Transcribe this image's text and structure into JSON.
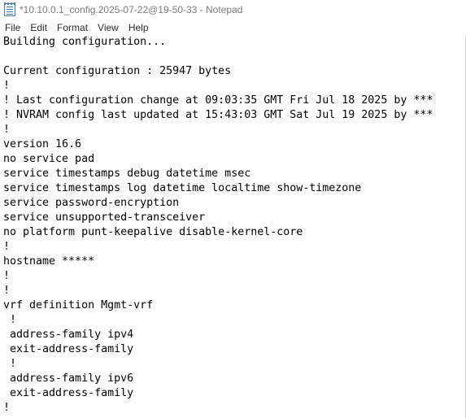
{
  "window": {
    "title": "*10.10.0.1_config.2025-07-22@19-50-33 - Notepad"
  },
  "menu": [
    "File",
    "Edit",
    "Format",
    "View",
    "Help"
  ],
  "editor": {
    "lines": [
      "Building configuration...",
      "",
      "Current configuration : 25947 bytes",
      "!",
      "! Last configuration change at 09:03:35 GMT Fri Jul 18 2025 by ***",
      "! NVRAM config last updated at 15:43:03 GMT Sat Jul 19 2025 by ***",
      "!",
      "version 16.6",
      "no service pad",
      "service timestamps debug datetime msec",
      "service timestamps log datetime localtime show-timezone",
      "service password-encryption",
      "service unsupported-transceiver",
      "no platform punt-keepalive disable-kernel-core",
      "!",
      "hostname *****",
      "!",
      "!",
      "vrf definition Mgmt-vrf",
      " !",
      " address-family ipv4",
      " exit-address-family",
      " !",
      " address-family ipv6",
      " exit-address-family",
      "!"
    ]
  }
}
